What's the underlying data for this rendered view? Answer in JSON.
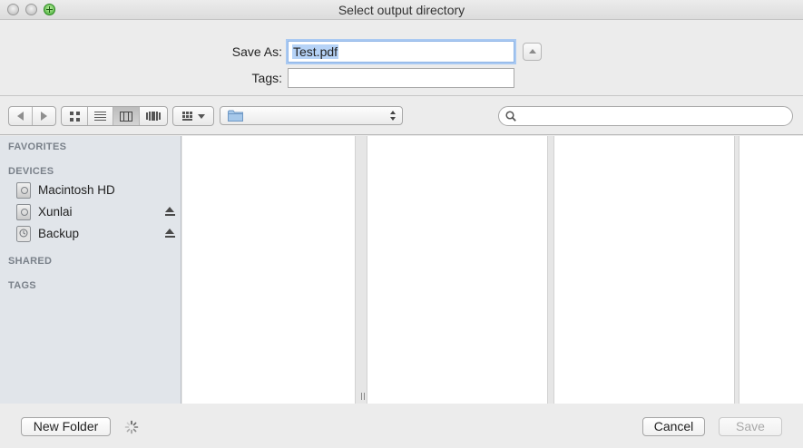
{
  "window": {
    "title": "Select output directory"
  },
  "save_form": {
    "save_as_label": "Save As:",
    "save_as_value": "Test.pdf",
    "tags_label": "Tags:",
    "tags_value": ""
  },
  "toolbar": {
    "back_icon": "chevron-left-icon",
    "forward_icon": "chevron-right-icon",
    "view_modes": [
      "icon-view",
      "list-view",
      "column-view",
      "cover-flow-view"
    ],
    "active_view": "column-view",
    "arrange_icon": "arrange-grid-icon",
    "path_popup_value": "",
    "search_value": ""
  },
  "sidebar": {
    "favorites_heading": "FAVORITES",
    "devices_heading": "DEVICES",
    "devices": [
      {
        "label": "Macintosh HD",
        "icon": "hard-disk-icon",
        "ejectable": false
      },
      {
        "label": "Xunlai",
        "icon": "hard-disk-icon",
        "ejectable": true
      },
      {
        "label": "Backup",
        "icon": "time-machine-disk-icon",
        "ejectable": true
      }
    ],
    "shared_heading": "SHARED",
    "tags_heading": "TAGS"
  },
  "footer": {
    "new_folder_label": "New Folder",
    "cancel_label": "Cancel",
    "save_label": "Save",
    "save_enabled": false
  },
  "colors": {
    "window_bg": "#ececec",
    "sidebar_bg": "#e1e5ea",
    "focus_ring": "#a9c9f2",
    "selection": "#b6d3f7",
    "zoom_green": "#3aa62d"
  }
}
